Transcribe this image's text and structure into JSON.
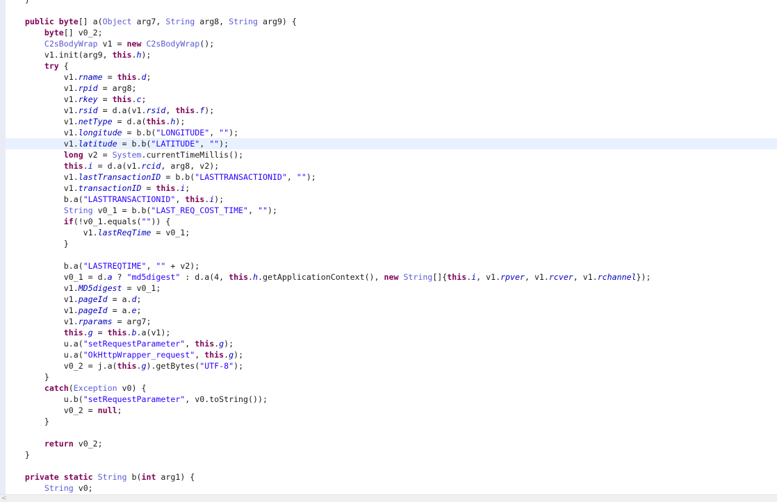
{
  "editor": {
    "highlighted_line": 13,
    "lines": [
      [
        [
          "tx",
          "    }"
        ]
      ],
      [],
      [
        [
          "tx",
          "    "
        ],
        [
          "kw",
          "public byte"
        ],
        [
          "tx",
          "[] a("
        ],
        [
          "ty",
          "Object"
        ],
        [
          "tx",
          " arg7, "
        ],
        [
          "ty",
          "String"
        ],
        [
          "tx",
          " arg8, "
        ],
        [
          "ty",
          "String"
        ],
        [
          "tx",
          " arg9) {"
        ]
      ],
      [
        [
          "tx",
          "        "
        ],
        [
          "kw",
          "byte"
        ],
        [
          "tx",
          "[] v0_2;"
        ]
      ],
      [
        [
          "tx",
          "        "
        ],
        [
          "ty",
          "C2sBodyWrap"
        ],
        [
          "tx",
          " v1 = "
        ],
        [
          "kw",
          "new"
        ],
        [
          "tx",
          " "
        ],
        [
          "ty",
          "C2sBodyWrap"
        ],
        [
          "tx",
          "();"
        ]
      ],
      [
        [
          "tx",
          "        v1.init(arg9, "
        ],
        [
          "kw",
          "this"
        ],
        [
          "tx",
          "."
        ],
        [
          "fi",
          "h"
        ],
        [
          "tx",
          ");"
        ]
      ],
      [
        [
          "tx",
          "        "
        ],
        [
          "kw",
          "try"
        ],
        [
          "tx",
          " {"
        ]
      ],
      [
        [
          "tx",
          "            v1."
        ],
        [
          "fi",
          "rname"
        ],
        [
          "tx",
          " = "
        ],
        [
          "kw",
          "this"
        ],
        [
          "tx",
          "."
        ],
        [
          "fi",
          "d"
        ],
        [
          "tx",
          ";"
        ]
      ],
      [
        [
          "tx",
          "            v1."
        ],
        [
          "fi",
          "rpid"
        ],
        [
          "tx",
          " = arg8;"
        ]
      ],
      [
        [
          "tx",
          "            v1."
        ],
        [
          "fi",
          "rkey"
        ],
        [
          "tx",
          " = "
        ],
        [
          "kw",
          "this"
        ],
        [
          "tx",
          "."
        ],
        [
          "fi",
          "c"
        ],
        [
          "tx",
          ";"
        ]
      ],
      [
        [
          "tx",
          "            v1."
        ],
        [
          "fi",
          "rsid"
        ],
        [
          "tx",
          " = d.a(v1."
        ],
        [
          "fi",
          "rsid"
        ],
        [
          "tx",
          ", "
        ],
        [
          "kw",
          "this"
        ],
        [
          "tx",
          "."
        ],
        [
          "fi",
          "f"
        ],
        [
          "tx",
          ");"
        ]
      ],
      [
        [
          "tx",
          "            v1."
        ],
        [
          "fi",
          "netType"
        ],
        [
          "tx",
          " = d.a("
        ],
        [
          "kw",
          "this"
        ],
        [
          "tx",
          "."
        ],
        [
          "fi",
          "h"
        ],
        [
          "tx",
          ");"
        ]
      ],
      [
        [
          "tx",
          "            v1."
        ],
        [
          "fi",
          "longitude"
        ],
        [
          "tx",
          " = b.b("
        ],
        [
          "st",
          "\"LONGITUDE\""
        ],
        [
          "tx",
          ", "
        ],
        [
          "st",
          "\"\""
        ],
        [
          "tx",
          ");"
        ]
      ],
      [
        [
          "tx",
          "            v1."
        ],
        [
          "fi",
          "latitude"
        ],
        [
          "tx",
          " = b.b("
        ],
        [
          "st",
          "\"LATITUDE\""
        ],
        [
          "tx",
          ", "
        ],
        [
          "st",
          "\"\""
        ],
        [
          "tx",
          ");"
        ]
      ],
      [
        [
          "tx",
          "            "
        ],
        [
          "kw",
          "long"
        ],
        [
          "tx",
          " v2 = "
        ],
        [
          "ty",
          "System"
        ],
        [
          "tx",
          ".currentTimeMillis();"
        ]
      ],
      [
        [
          "tx",
          "            "
        ],
        [
          "kw",
          "this"
        ],
        [
          "tx",
          "."
        ],
        [
          "fi",
          "i"
        ],
        [
          "tx",
          " = d.a(v1."
        ],
        [
          "fi",
          "rcid"
        ],
        [
          "tx",
          ", arg8, v2);"
        ]
      ],
      [
        [
          "tx",
          "            v1."
        ],
        [
          "fi",
          "lastTransactionID"
        ],
        [
          "tx",
          " = b.b("
        ],
        [
          "st",
          "\"LASTTRANSACTIONID\""
        ],
        [
          "tx",
          ", "
        ],
        [
          "st",
          "\"\""
        ],
        [
          "tx",
          ");"
        ]
      ],
      [
        [
          "tx",
          "            v1."
        ],
        [
          "fi",
          "transactionID"
        ],
        [
          "tx",
          " = "
        ],
        [
          "kw",
          "this"
        ],
        [
          "tx",
          "."
        ],
        [
          "fi",
          "i"
        ],
        [
          "tx",
          ";"
        ]
      ],
      [
        [
          "tx",
          "            b.a("
        ],
        [
          "st",
          "\"LASTTRANSACTIONID\""
        ],
        [
          "tx",
          ", "
        ],
        [
          "kw",
          "this"
        ],
        [
          "tx",
          "."
        ],
        [
          "fi",
          "i"
        ],
        [
          "tx",
          ");"
        ]
      ],
      [
        [
          "tx",
          "            "
        ],
        [
          "ty",
          "String"
        ],
        [
          "tx",
          " v0_1 = b.b("
        ],
        [
          "st",
          "\"LAST_REQ_COST_TIME\""
        ],
        [
          "tx",
          ", "
        ],
        [
          "st",
          "\"\""
        ],
        [
          "tx",
          ");"
        ]
      ],
      [
        [
          "tx",
          "            "
        ],
        [
          "kw",
          "if"
        ],
        [
          "tx",
          "(!v0_1.equals("
        ],
        [
          "st",
          "\"\""
        ],
        [
          "tx",
          ")) {"
        ]
      ],
      [
        [
          "tx",
          "                v1."
        ],
        [
          "fi",
          "lastReqTime"
        ],
        [
          "tx",
          " = v0_1;"
        ]
      ],
      [
        [
          "tx",
          "            }"
        ]
      ],
      [],
      [
        [
          "tx",
          "            b.a("
        ],
        [
          "st",
          "\"LASTREQTIME\""
        ],
        [
          "tx",
          ", "
        ],
        [
          "st",
          "\"\""
        ],
        [
          "tx",
          " + v2);"
        ]
      ],
      [
        [
          "tx",
          "            v0_1 = d."
        ],
        [
          "fi",
          "a"
        ],
        [
          "tx",
          " ? "
        ],
        [
          "st",
          "\"md5digest\""
        ],
        [
          "tx",
          " : d.a(4, "
        ],
        [
          "kw",
          "this"
        ],
        [
          "tx",
          "."
        ],
        [
          "fi",
          "h"
        ],
        [
          "tx",
          ".getApplicationContext(), "
        ],
        [
          "kw",
          "new"
        ],
        [
          "tx",
          " "
        ],
        [
          "ty",
          "String"
        ],
        [
          "tx",
          "[]{"
        ],
        [
          "kw",
          "this"
        ],
        [
          "tx",
          "."
        ],
        [
          "fi",
          "i"
        ],
        [
          "tx",
          ", v1."
        ],
        [
          "fi",
          "rpver"
        ],
        [
          "tx",
          ", v1."
        ],
        [
          "fi",
          "rcver"
        ],
        [
          "tx",
          ", v1."
        ],
        [
          "fi",
          "rchannel"
        ],
        [
          "tx",
          "});"
        ]
      ],
      [
        [
          "tx",
          "            v1."
        ],
        [
          "fi",
          "MD5digest"
        ],
        [
          "tx",
          " = v0_1;"
        ]
      ],
      [
        [
          "tx",
          "            v1."
        ],
        [
          "fi",
          "pageId"
        ],
        [
          "tx",
          " = a."
        ],
        [
          "fi",
          "d"
        ],
        [
          "tx",
          ";"
        ]
      ],
      [
        [
          "tx",
          "            v1."
        ],
        [
          "fi",
          "pageId"
        ],
        [
          "tx",
          " = a."
        ],
        [
          "fi",
          "e"
        ],
        [
          "tx",
          ";"
        ]
      ],
      [
        [
          "tx",
          "            v1."
        ],
        [
          "fi",
          "rparams"
        ],
        [
          "tx",
          " = arg7;"
        ]
      ],
      [
        [
          "tx",
          "            "
        ],
        [
          "kw",
          "this"
        ],
        [
          "tx",
          "."
        ],
        [
          "fi",
          "g"
        ],
        [
          "tx",
          " = "
        ],
        [
          "kw",
          "this"
        ],
        [
          "tx",
          "."
        ],
        [
          "fi",
          "b"
        ],
        [
          "tx",
          ".a(v1);"
        ]
      ],
      [
        [
          "tx",
          "            u.a("
        ],
        [
          "st",
          "\"setRequestParameter\""
        ],
        [
          "tx",
          ", "
        ],
        [
          "kw",
          "this"
        ],
        [
          "tx",
          "."
        ],
        [
          "fi",
          "g"
        ],
        [
          "tx",
          ");"
        ]
      ],
      [
        [
          "tx",
          "            u.a("
        ],
        [
          "st",
          "\"OkHttpWrapper_request\""
        ],
        [
          "tx",
          ", "
        ],
        [
          "kw",
          "this"
        ],
        [
          "tx",
          "."
        ],
        [
          "fi",
          "g"
        ],
        [
          "tx",
          ");"
        ]
      ],
      [
        [
          "tx",
          "            v0_2 = j.a("
        ],
        [
          "kw",
          "this"
        ],
        [
          "tx",
          "."
        ],
        [
          "fi",
          "g"
        ],
        [
          "tx",
          ").getBytes("
        ],
        [
          "st",
          "\"UTF-8\""
        ],
        [
          "tx",
          ");"
        ]
      ],
      [
        [
          "tx",
          "        }"
        ]
      ],
      [
        [
          "tx",
          "        "
        ],
        [
          "kw",
          "catch"
        ],
        [
          "tx",
          "("
        ],
        [
          "ty",
          "Exception"
        ],
        [
          "tx",
          " v0) {"
        ]
      ],
      [
        [
          "tx",
          "            u.b("
        ],
        [
          "st",
          "\"setRequestParameter\""
        ],
        [
          "tx",
          ", v0.toString());"
        ]
      ],
      [
        [
          "tx",
          "            v0_2 = "
        ],
        [
          "kw",
          "null"
        ],
        [
          "tx",
          ";"
        ]
      ],
      [
        [
          "tx",
          "        }"
        ]
      ],
      [],
      [
        [
          "tx",
          "        "
        ],
        [
          "kw",
          "return"
        ],
        [
          "tx",
          " v0_2;"
        ]
      ],
      [
        [
          "tx",
          "    }"
        ]
      ],
      [],
      [
        [
          "tx",
          "    "
        ],
        [
          "kw",
          "private static"
        ],
        [
          "tx",
          " "
        ],
        [
          "ty",
          "String"
        ],
        [
          "tx",
          " b("
        ],
        [
          "kw",
          "int"
        ],
        [
          "tx",
          " arg1) {"
        ]
      ],
      [
        [
          "tx",
          "        "
        ],
        [
          "ty",
          "String"
        ],
        [
          "tx",
          " v0;"
        ]
      ]
    ]
  },
  "scrollbar": {
    "left_arrow": "<"
  }
}
